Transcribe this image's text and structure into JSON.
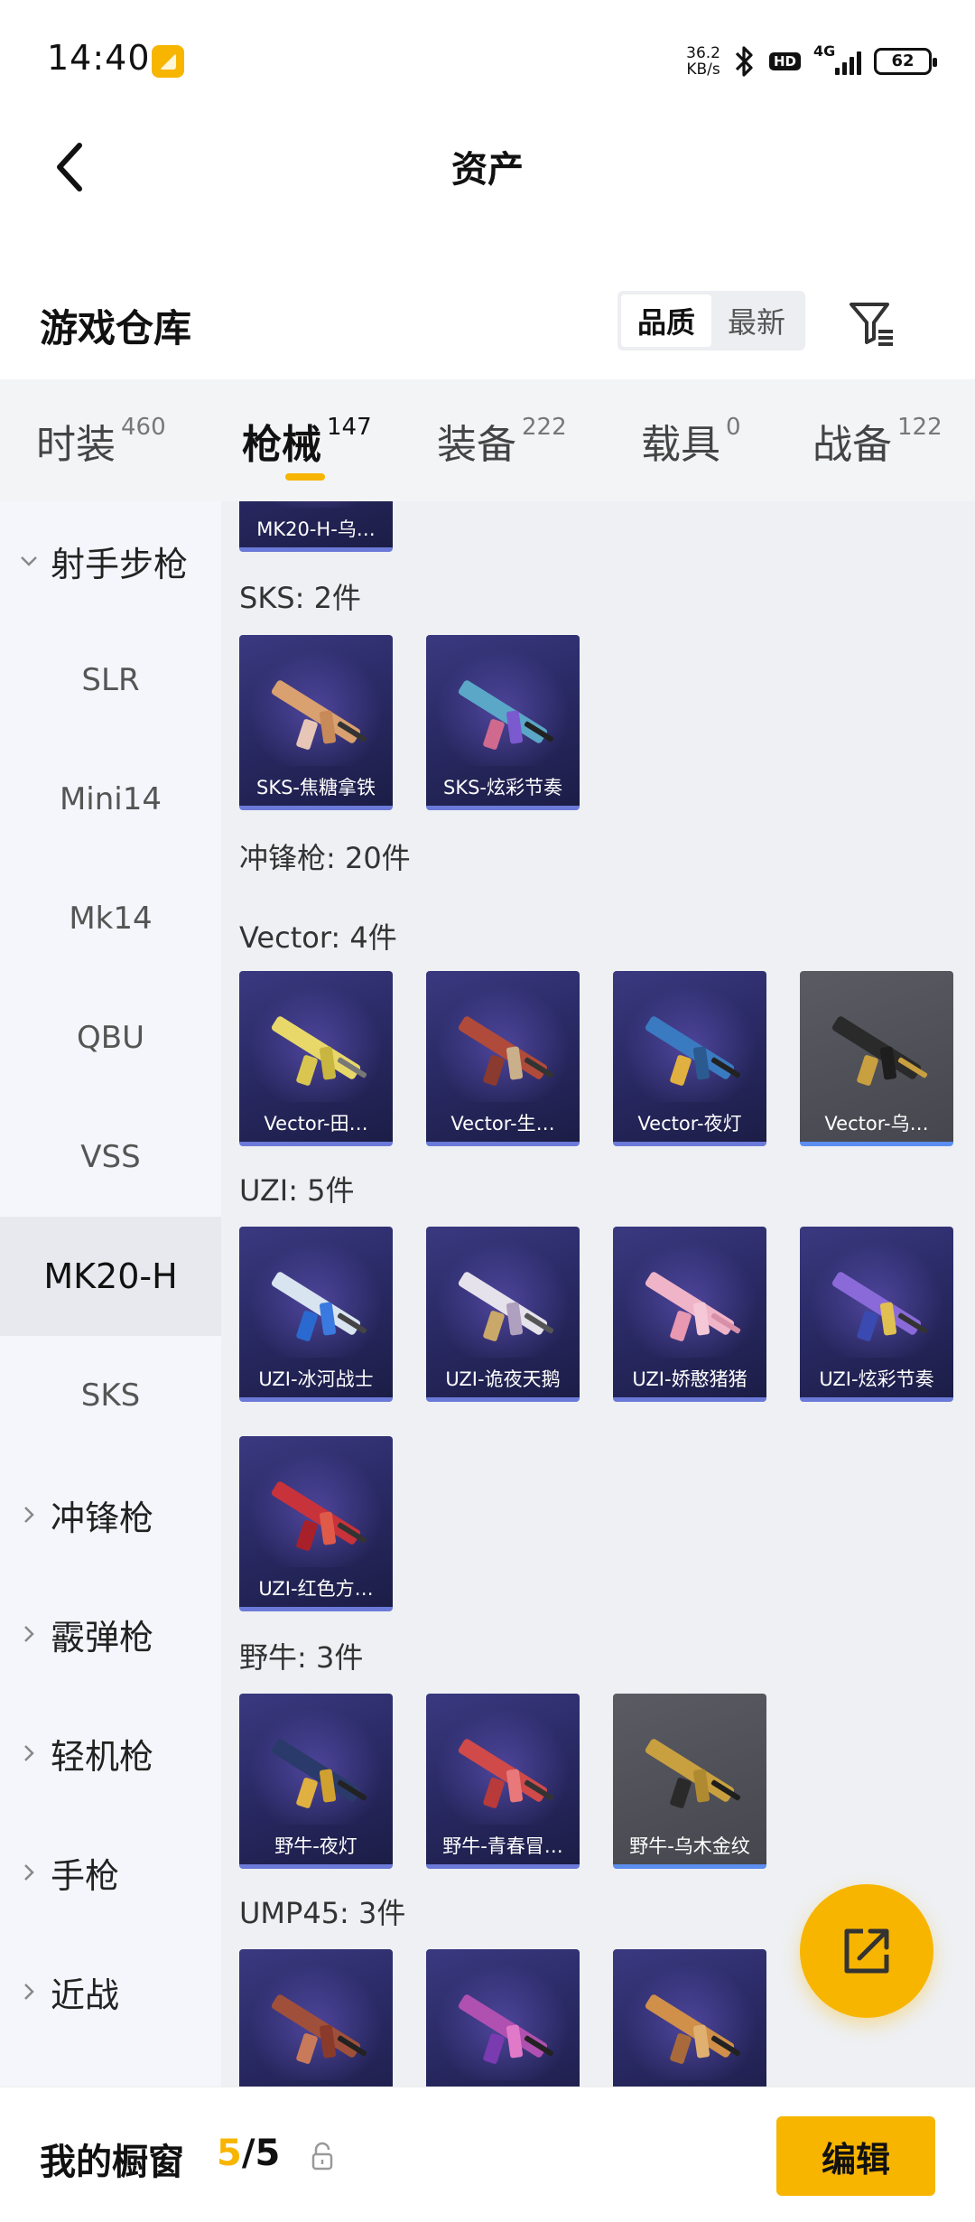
{
  "status_bar": {
    "time": "14:40",
    "net_speed_value": "36.2",
    "net_speed_unit": "KB/s",
    "hd_label": "HD",
    "network_type": "4G",
    "battery": "62"
  },
  "header": {
    "title": "资产",
    "back_icon": "chevron-left-icon"
  },
  "warehouse": {
    "title": "游戏仓库",
    "sort_options": [
      "品质",
      "最新"
    ],
    "active_sort": "品质",
    "filter_icon": "filter-icon"
  },
  "tabs": [
    {
      "label": "时装",
      "count": "460"
    },
    {
      "label": "枪械",
      "count": "147"
    },
    {
      "label": "装备",
      "count": "222"
    },
    {
      "label": "载具",
      "count": "0"
    },
    {
      "label": "战备",
      "count": "122"
    }
  ],
  "active_tab": "枪械",
  "sidebar": {
    "items": [
      {
        "label": "射手步枪",
        "type": "group-expanded"
      },
      {
        "label": "SLR",
        "type": "sub"
      },
      {
        "label": "Mini14",
        "type": "sub"
      },
      {
        "label": "Mk14",
        "type": "sub"
      },
      {
        "label": "QBU",
        "type": "sub"
      },
      {
        "label": "VSS",
        "type": "sub"
      },
      {
        "label": "MK20-H",
        "type": "sub-active"
      },
      {
        "label": "SKS",
        "type": "sub"
      },
      {
        "label": "冲锋枪",
        "type": "group"
      },
      {
        "label": "霰弹枪",
        "type": "group"
      },
      {
        "label": "轻机枪",
        "type": "group"
      },
      {
        "label": "手枪",
        "type": "group"
      },
      {
        "label": "近战",
        "type": "group"
      }
    ]
  },
  "content": {
    "top_partial_card": "MK20-H-乌…",
    "sks": {
      "title": "SKS: 2件",
      "items": [
        "SKS-焦糖拿铁",
        "SKS-炫彩节奏"
      ]
    },
    "smg_title": "冲锋枪: 20件",
    "vector": {
      "title": "Vector: 4件",
      "items": [
        "Vector-田…",
        "Vector-生…",
        "Vector-夜灯",
        "Vector-乌…"
      ]
    },
    "uzi": {
      "title": "UZI: 5件",
      "items": [
        "UZI-冰河战士",
        "UZI-诡夜天鹅",
        "UZI-娇憨猪猪",
        "UZI-炫彩节奏",
        "UZI-红色方…"
      ]
    },
    "bizon": {
      "title": "野牛: 3件",
      "items": [
        "野牛-夜灯",
        "野牛-青春冒…",
        "野牛-乌木金纹"
      ]
    },
    "ump": {
      "title": "UMP45: 3件"
    }
  },
  "colors": {
    "accent": "#f7b500",
    "card_purple": "#2a2a66",
    "card_gray": "#4f5057",
    "card_border_blue": "#6b7ad8"
  },
  "fab": {
    "icon": "share-export-icon"
  },
  "bottom_bar": {
    "title": "我的橱窗",
    "count_current": "5",
    "count_total": "/5",
    "lock_icon": "lock-icon",
    "edit_label": "编辑"
  }
}
